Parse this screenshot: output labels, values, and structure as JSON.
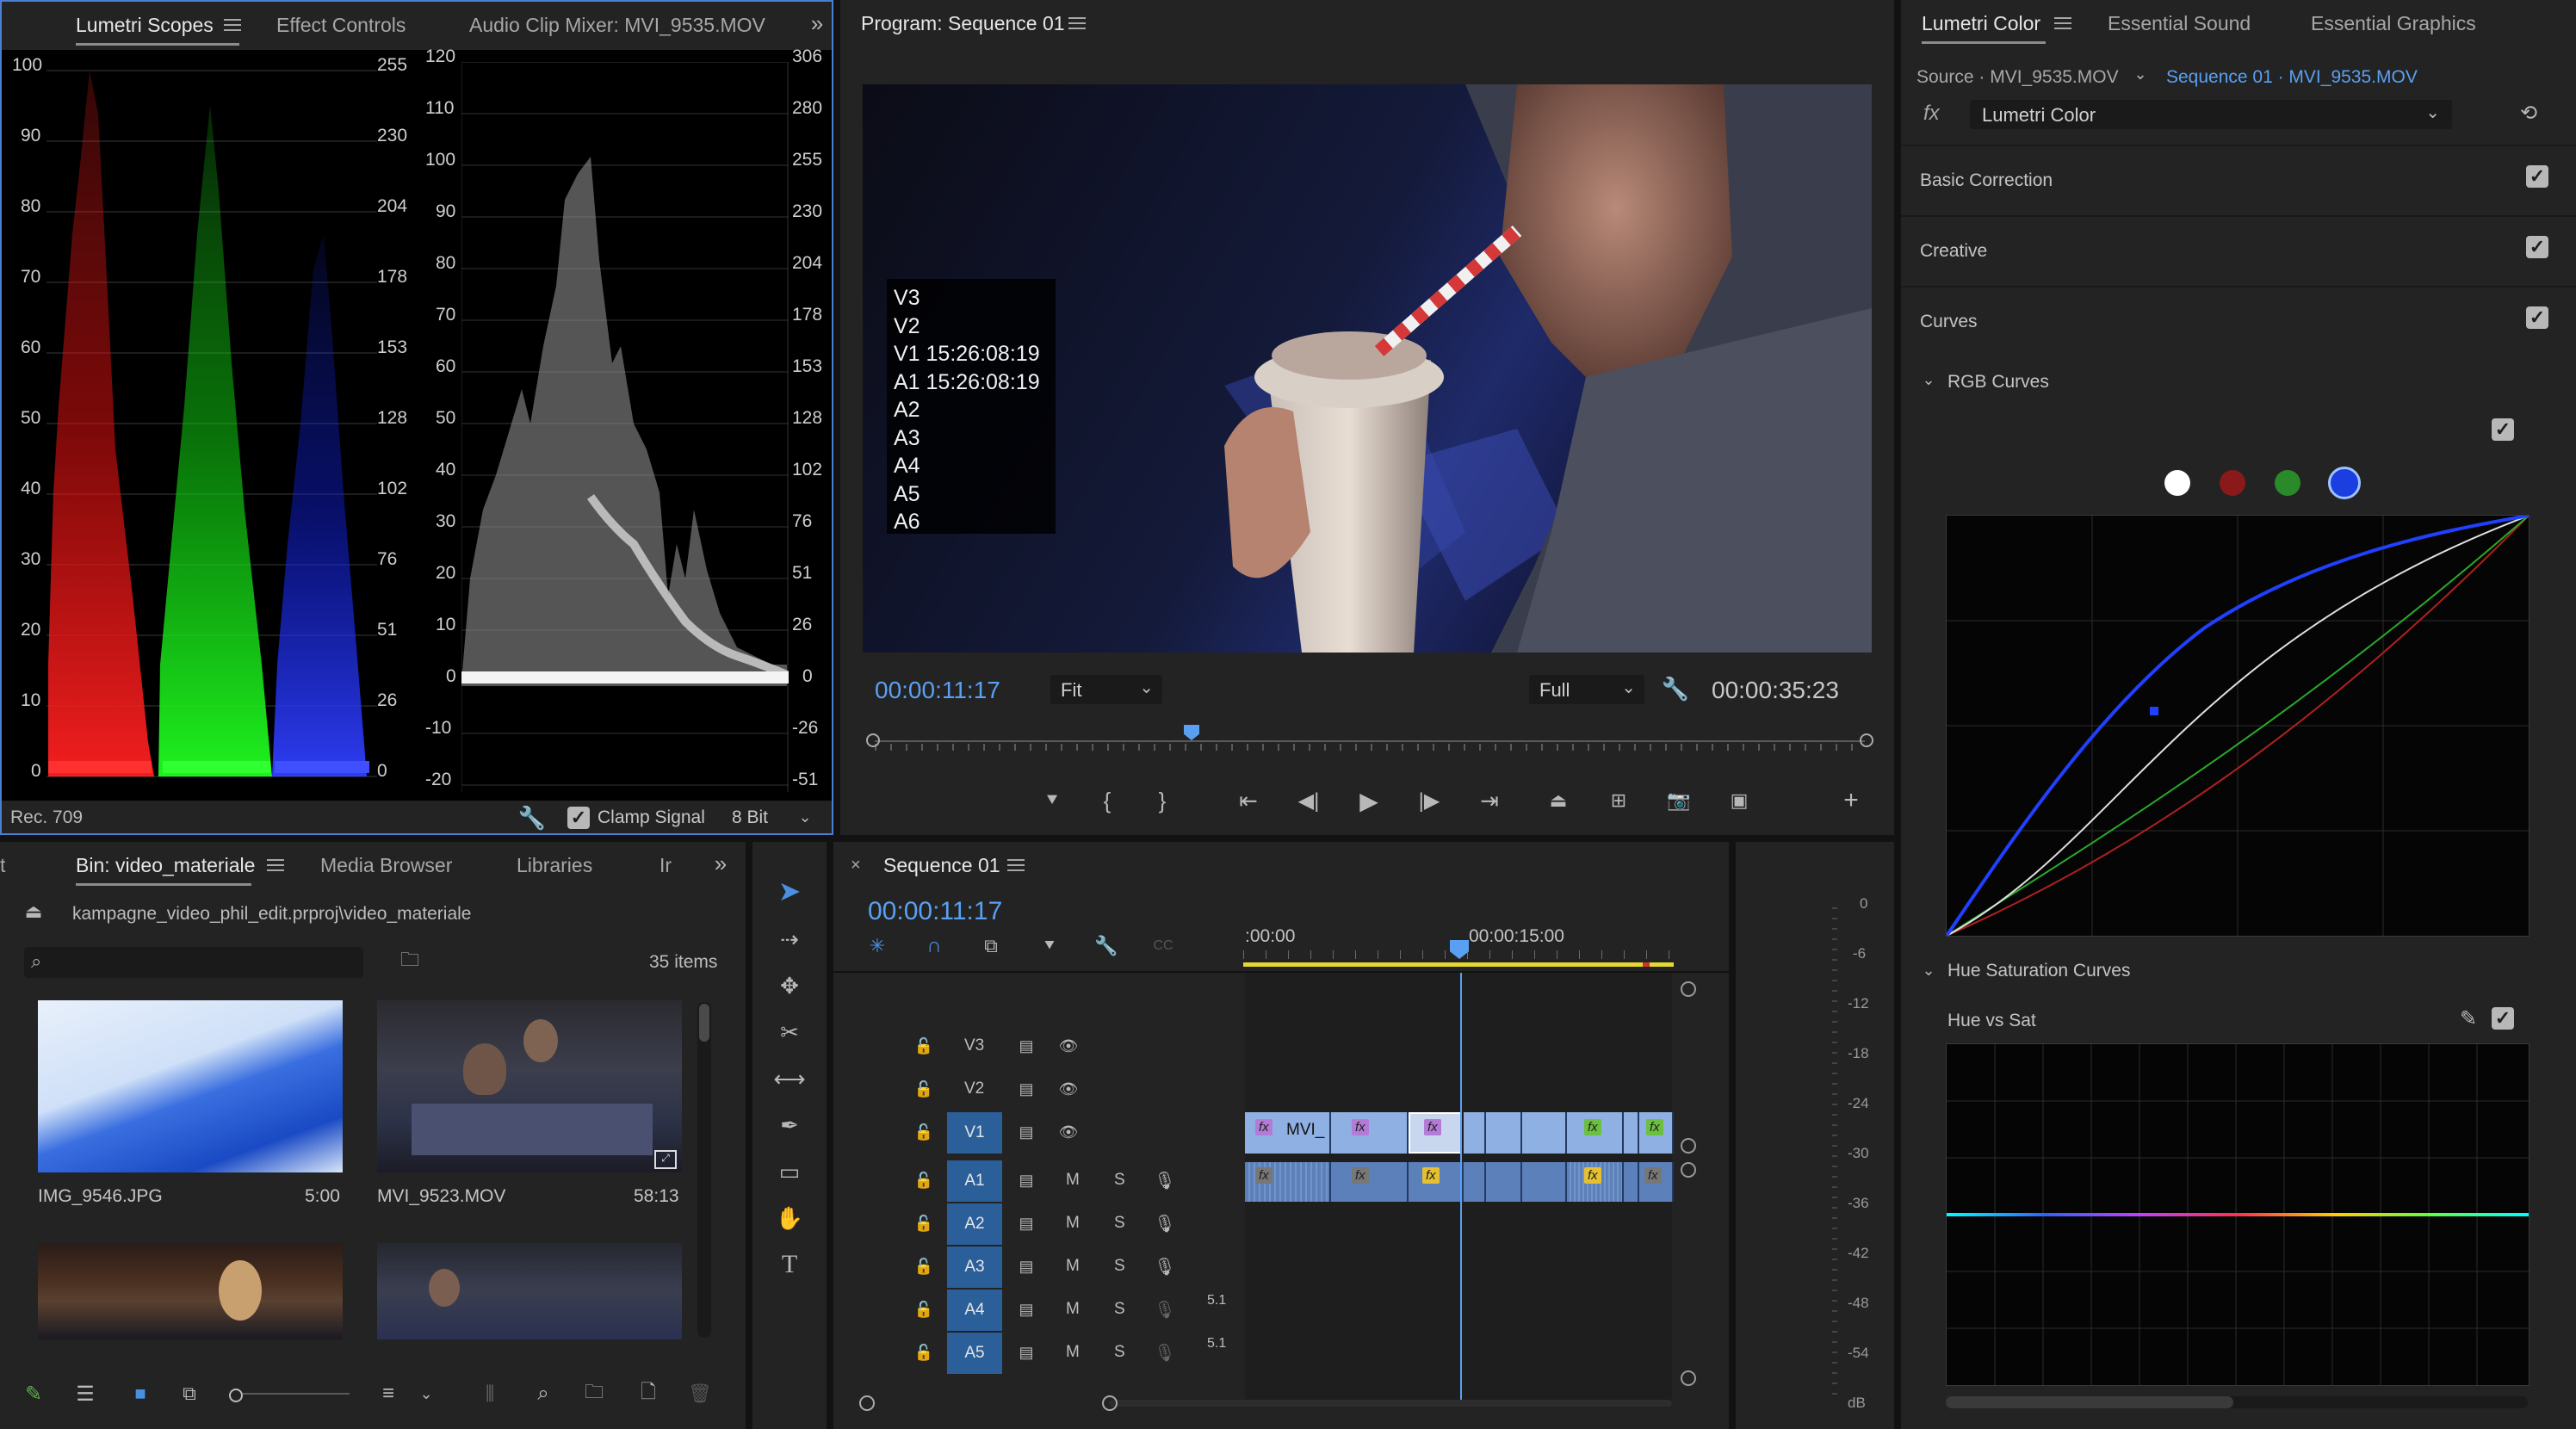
{
  "scopes_panel": {
    "tabs": [
      "Lumetri Scopes",
      "Effect Controls",
      "Audio Clip Mixer: MVI_9535.MOV"
    ],
    "parade_left_scale": [
      "100",
      "90",
      "80",
      "70",
      "60",
      "50",
      "40",
      "30",
      "20",
      "10",
      "0"
    ],
    "parade_right_scale": [
      "255",
      "230",
      "204",
      "178",
      "153",
      "128",
      "102",
      "76",
      "51",
      "26",
      "0"
    ],
    "wave_left_scale": [
      "120",
      "110",
      "100",
      "90",
      "80",
      "70",
      "60",
      "50",
      "40",
      "30",
      "20",
      "10",
      "0",
      "-10",
      "-20"
    ],
    "wave_right_scale": [
      "306",
      "280",
      "255",
      "230",
      "204",
      "178",
      "153",
      "128",
      "102",
      "76",
      "51",
      "26",
      "0",
      "-26",
      "-51"
    ],
    "footer": {
      "standard": "Rec. 709",
      "clamp_label": "Clamp Signal",
      "bit_depth": "8 Bit"
    }
  },
  "program_monitor": {
    "title": "Program: Sequence 01",
    "track_overlay": [
      "V3",
      "V2",
      "V1 15:26:08:19",
      "A1 15:26:08:19",
      "A2",
      "A3",
      "A4",
      "A5",
      "A6"
    ],
    "current_time": "00:00:11:17",
    "zoom": "Fit",
    "resolution": "Full",
    "duration": "00:00:35:23",
    "playhead_fraction": 0.32
  },
  "lumetri_color": {
    "tabs": [
      "Lumetri Color",
      "Essential Sound",
      "Essential Graphics"
    ],
    "source": "Source · MVI_9535.MOV",
    "sequence": "Sequence 01 · MVI_9535.MOV",
    "fx_name": "Lumetri Color",
    "sections": [
      "Basic Correction",
      "Creative",
      "Curves"
    ],
    "rgb_curves": "RGB Curves",
    "hue_sat": "Hue Saturation Curves",
    "hue_vs_sat": "Hue vs Sat",
    "colors": {
      "white": "#ffffff",
      "red": "#8a1a1a",
      "green": "#2a8a2a",
      "blue": "#1a3ee0"
    }
  },
  "project_panel": {
    "tabs": [
      "Bin: video_materiale",
      "Media Browser",
      "Libraries",
      "Ir"
    ],
    "path": "kampagne_video_phil_edit.prproj\\video_materiale",
    "item_count": "35 items",
    "items": [
      {
        "name": "IMG_9546.JPG",
        "duration": "5:00"
      },
      {
        "name": "MVI_9523.MOV",
        "duration": "58:13"
      }
    ]
  },
  "timeline": {
    "title": "Sequence 01",
    "current_time": "00:00:11:17",
    "ruler": [
      ":00:00",
      "00:00:15:00"
    ],
    "video_tracks": [
      "V3",
      "V2",
      "V1"
    ],
    "audio_tracks": [
      "A1",
      "A2",
      "A3",
      "A4",
      "A5"
    ],
    "audio_channels": {
      "A4": "5.1",
      "A5": "5.1"
    },
    "clip_label": "MVI_",
    "mute": "M",
    "solo": "S"
  },
  "audio_meter": {
    "scale": [
      "0",
      "-6",
      "-12",
      "-18",
      "-24",
      "-30",
      "-36",
      "-42",
      "-48",
      "-54",
      "dB"
    ]
  }
}
